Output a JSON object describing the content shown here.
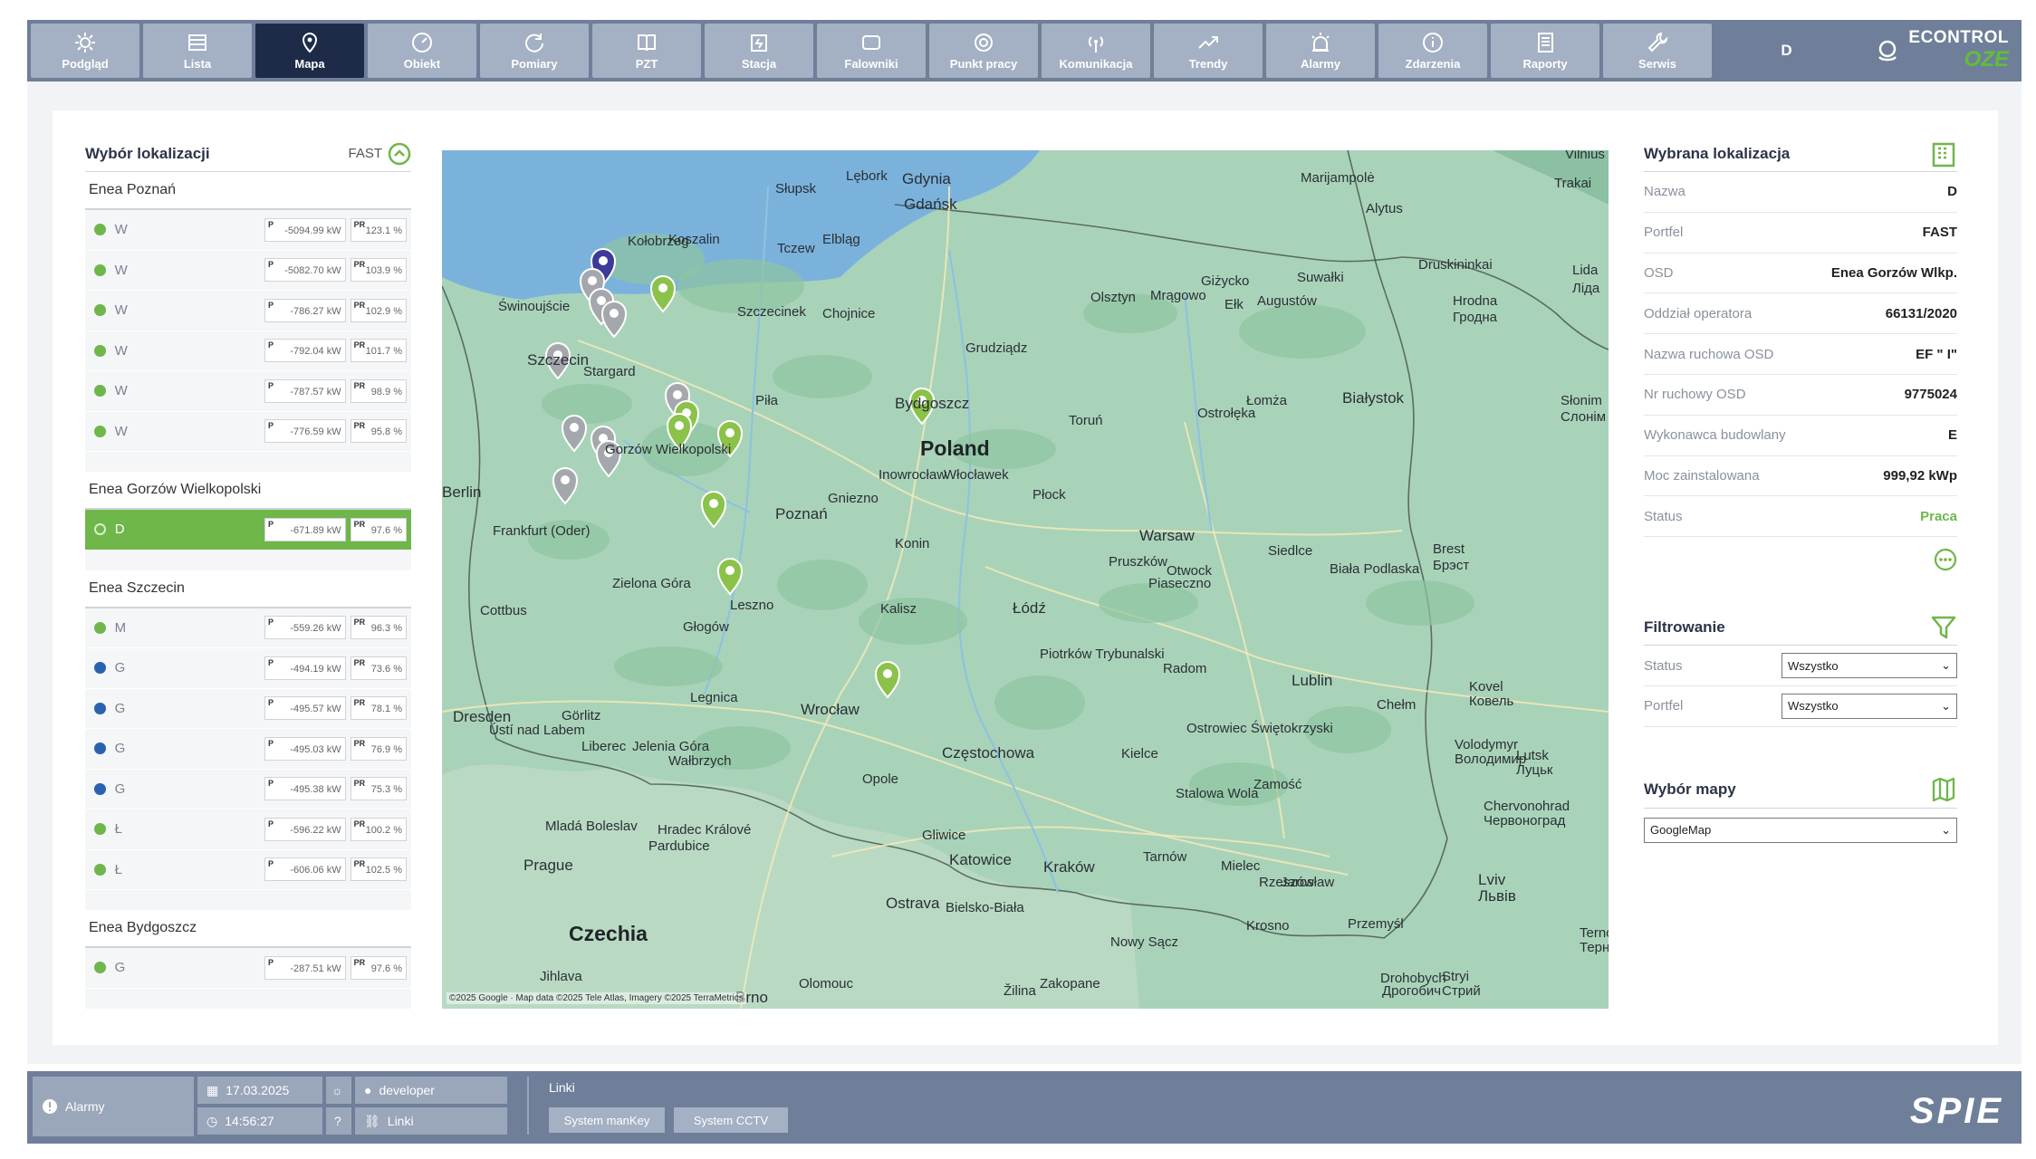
{
  "nav": [
    {
      "label": "Podgląd",
      "icon": "sun-icon"
    },
    {
      "label": "Lista",
      "icon": "list-icon"
    },
    {
      "label": "Mapa",
      "icon": "map-pin-icon",
      "active": true
    },
    {
      "label": "Obiekt",
      "icon": "gauge-icon"
    },
    {
      "label": "Pomiary",
      "icon": "measure-icon"
    },
    {
      "label": "PZT",
      "icon": "book-icon"
    },
    {
      "label": "Stacja",
      "icon": "station-icon"
    },
    {
      "label": "Falowniki",
      "icon": "inverter-icon"
    },
    {
      "label": "Punkt pracy",
      "icon": "target-icon"
    },
    {
      "label": "Komunikacja",
      "icon": "antenna-icon"
    },
    {
      "label": "Trendy",
      "icon": "trend-icon"
    },
    {
      "label": "Alarmy",
      "icon": "siren-icon"
    },
    {
      "label": "Zdarzenia",
      "icon": "info-icon"
    },
    {
      "label": "Raporty",
      "icon": "report-icon"
    },
    {
      "label": "Serwis",
      "icon": "wrench-icon"
    }
  ],
  "header": {
    "user": "D",
    "brand": "ECONTROL",
    "brand_sub": "OZE"
  },
  "left": {
    "title": "Wybór lokalizacji",
    "fast_label": "FAST",
    "groups": [
      {
        "title": "Enea Poznań",
        "rows": [
          {
            "name": "W",
            "p": "-5094.99 kW",
            "pr": "123.1 %",
            "color": "#6fb64b"
          },
          {
            "name": "W",
            "p": "-5082.70 kW",
            "pr": "103.9 %",
            "color": "#6fb64b"
          },
          {
            "name": "W",
            "p": "-786.27 kW",
            "pr": "102.9 %",
            "color": "#6fb64b"
          },
          {
            "name": "W",
            "p": "-792.04 kW",
            "pr": "101.7 %",
            "color": "#6fb64b"
          },
          {
            "name": "W",
            "p": "-787.57 kW",
            "pr": "98.9 %",
            "color": "#6fb64b"
          },
          {
            "name": "W",
            "p": "-776.59 kW",
            "pr": "95.8 %",
            "color": "#6fb64b"
          }
        ]
      },
      {
        "title": "Enea Gorzów Wielkopolski",
        "rows": [
          {
            "name": "D",
            "p": "-671.89 kW",
            "pr": "97.6 %",
            "color": "#6fb64b",
            "selected": true
          }
        ]
      },
      {
        "title": "Enea Szczecin",
        "rows": [
          {
            "name": "M",
            "p": "-559.26 kW",
            "pr": "96.3 %",
            "color": "#6fb64b"
          },
          {
            "name": "G",
            "p": "-494.19 kW",
            "pr": "73.6 %",
            "color": "#2a62b0"
          },
          {
            "name": "G",
            "p": "-495.57 kW",
            "pr": "78.1 %",
            "color": "#2a62b0"
          },
          {
            "name": "G",
            "p": "-495.03 kW",
            "pr": "76.9 %",
            "color": "#2a62b0"
          },
          {
            "name": "G",
            "p": "-495.38 kW",
            "pr": "75.3 %",
            "color": "#2a62b0"
          },
          {
            "name": "Ł",
            "p": "-596.22 kW",
            "pr": "100.2 %",
            "color": "#6fb64b"
          },
          {
            "name": "Ł",
            "p": "-606.06 kW",
            "pr": "102.5 %",
            "color": "#6fb64b"
          }
        ]
      },
      {
        "title": "Enea Bydgoszcz",
        "rows": [
          {
            "name": "G",
            "p": "-287.51 kW",
            "pr": "97.6 %",
            "color": "#6fb64b"
          }
        ]
      }
    ],
    "p_label": "P",
    "pr_label": "PR"
  },
  "map": {
    "attribution": "©2025 Google · Map data ©2025 Tele Atlas, Imagery ©2025 TerraMetrics",
    "country_labels": [
      {
        "text": "Poland",
        "cls": "country"
      },
      {
        "text": "Czechia",
        "cls": "country"
      }
    ],
    "cities": [
      {
        "text": "Gdynia",
        "cls": "mid"
      },
      {
        "text": "Gdańsk",
        "cls": "mid"
      },
      {
        "text": "Słupsk",
        "cls": ""
      },
      {
        "text": "Lębork",
        "cls": ""
      },
      {
        "text": "Kołobrzeg",
        "cls": ""
      },
      {
        "text": "Koszalin",
        "cls": ""
      },
      {
        "text": "Elbląg",
        "cls": ""
      },
      {
        "text": "Tczew",
        "cls": ""
      },
      {
        "text": "Olsztyn",
        "cls": ""
      },
      {
        "text": "Mrągowo",
        "cls": ""
      },
      {
        "text": "Giżycko",
        "cls": ""
      },
      {
        "text": "Ełk",
        "cls": ""
      },
      {
        "text": "Augustów",
        "cls": ""
      },
      {
        "text": "Suwałki",
        "cls": ""
      },
      {
        "text": "Marijampolė",
        "cls": ""
      },
      {
        "text": "Alytus",
        "cls": ""
      },
      {
        "text": "Druskininkai",
        "cls": ""
      },
      {
        "text": "Hrodna",
        "cls": ""
      },
      {
        "text": "Гродна",
        "cls": ""
      },
      {
        "text": "Vilnius",
        "cls": ""
      },
      {
        "text": "Trakai",
        "cls": ""
      },
      {
        "text": "Lida",
        "cls": ""
      },
      {
        "text": "Ліда",
        "cls": ""
      },
      {
        "text": "Szczecin",
        "cls": "mid"
      },
      {
        "text": "Stargard",
        "cls": ""
      },
      {
        "text": "Świnoujście",
        "cls": ""
      },
      {
        "text": "Szczecinek",
        "cls": ""
      },
      {
        "text": "Chojnice",
        "cls": ""
      },
      {
        "text": "Grudziądz",
        "cls": ""
      },
      {
        "text": "Bydgoszcz",
        "cls": "mid"
      },
      {
        "text": "Toruń",
        "cls": ""
      },
      {
        "text": "Piła",
        "cls": ""
      },
      {
        "text": "Ostrołęka",
        "cls": ""
      },
      {
        "text": "Łomża",
        "cls": ""
      },
      {
        "text": "Białystok",
        "cls": "mid"
      },
      {
        "text": "Słonim",
        "cls": ""
      },
      {
        "text": "Слонім",
        "cls": ""
      },
      {
        "text": "Gorzów Wielkopolski",
        "cls": ""
      },
      {
        "text": "Inowrocław",
        "cls": ""
      },
      {
        "text": "Włocławek",
        "cls": ""
      },
      {
        "text": "Płock",
        "cls": ""
      },
      {
        "text": "Gniezno",
        "cls": ""
      },
      {
        "text": "Poznań",
        "cls": "mid"
      },
      {
        "text": "Berlin",
        "cls": "mid"
      },
      {
        "text": "Frankfurt (Oder)",
        "cls": ""
      },
      {
        "text": "Konin",
        "cls": ""
      },
      {
        "text": "Warsaw",
        "cls": "mid"
      },
      {
        "text": "Siedlce",
        "cls": ""
      },
      {
        "text": "Pruszków",
        "cls": ""
      },
      {
        "text": "Otwock",
        "cls": ""
      },
      {
        "text": "Piaseczno",
        "cls": ""
      },
      {
        "text": "Biała Podlaska",
        "cls": ""
      },
      {
        "text": "Brest",
        "cls": ""
      },
      {
        "text": "Брэст",
        "cls": ""
      },
      {
        "text": "Zielona Góra",
        "cls": ""
      },
      {
        "text": "Cottbus",
        "cls": ""
      },
      {
        "text": "Leszno",
        "cls": ""
      },
      {
        "text": "Kalisz",
        "cls": ""
      },
      {
        "text": "Łódź",
        "cls": "mid"
      },
      {
        "text": "Głogów",
        "cls": ""
      },
      {
        "text": "Piotrków Trybunalski",
        "cls": ""
      },
      {
        "text": "Radom",
        "cls": ""
      },
      {
        "text": "Lublin",
        "cls": "mid"
      },
      {
        "text": "Chełm",
        "cls": ""
      },
      {
        "text": "Kovel",
        "cls": ""
      },
      {
        "text": "Ковель",
        "cls": ""
      },
      {
        "text": "Dresden",
        "cls": "mid"
      },
      {
        "text": "Görlitz",
        "cls": ""
      },
      {
        "text": "Legnica",
        "cls": ""
      },
      {
        "text": "Wrocław",
        "cls": "mid"
      },
      {
        "text": "Ostrowiec Świętokrzyski",
        "cls": ""
      },
      {
        "text": "Volodymyr",
        "cls": ""
      },
      {
        "text": "Володимир",
        "cls": ""
      },
      {
        "text": "Lutsk",
        "cls": ""
      },
      {
        "text": "Луцьк",
        "cls": ""
      },
      {
        "text": "Ústí nad Labem",
        "cls": ""
      },
      {
        "text": "Liberec",
        "cls": ""
      },
      {
        "text": "Jelenia Góra",
        "cls": ""
      },
      {
        "text": "Wałbrzych",
        "cls": ""
      },
      {
        "text": "Częstochowa",
        "cls": "mid"
      },
      {
        "text": "Kielce",
        "cls": ""
      },
      {
        "text": "Zamość",
        "cls": ""
      },
      {
        "text": "Stalowa Wola",
        "cls": ""
      },
      {
        "text": "Chervonohrad",
        "cls": ""
      },
      {
        "text": "Червоноград",
        "cls": ""
      },
      {
        "text": "Opole",
        "cls": ""
      },
      {
        "text": "Mladá Boleslav",
        "cls": ""
      },
      {
        "text": "Hradec Králové",
        "cls": ""
      },
      {
        "text": "Pardubice",
        "cls": ""
      },
      {
        "text": "Gliwice",
        "cls": ""
      },
      {
        "text": "Katowice",
        "cls": "mid"
      },
      {
        "text": "Kraków",
        "cls": "mid"
      },
      {
        "text": "Tarnów",
        "cls": ""
      },
      {
        "text": "Mielec",
        "cls": ""
      },
      {
        "text": "Rzeszów",
        "cls": ""
      },
      {
        "text": "Jarosław",
        "cls": ""
      },
      {
        "text": "Prague",
        "cls": "mid"
      },
      {
        "text": "Lviv",
        "cls": "mid"
      },
      {
        "text": "Львів",
        "cls": "mid"
      },
      {
        "text": "Ostrava",
        "cls": "mid"
      },
      {
        "text": "Bielsko-Biała",
        "cls": ""
      },
      {
        "text": "Przemyśl",
        "cls": ""
      },
      {
        "text": "Krosno",
        "cls": ""
      },
      {
        "text": "Nowy Sącz",
        "cls": ""
      },
      {
        "text": "Jihlava",
        "cls": ""
      },
      {
        "text": "Olomouc",
        "cls": ""
      },
      {
        "text": "Žilina",
        "cls": ""
      },
      {
        "text": "Zakopane",
        "cls": ""
      },
      {
        "text": "Drohobych",
        "cls": ""
      },
      {
        "text": "Дрогобич",
        "cls": ""
      },
      {
        "text": "Stryi",
        "cls": ""
      },
      {
        "text": "Стрий",
        "cls": ""
      },
      {
        "text": "Brno",
        "cls": "mid"
      },
      {
        "text": "Terno",
        "cls": ""
      },
      {
        "text": "Терно",
        "cls": ""
      }
    ]
  },
  "right": {
    "title": "Wybrana lokalizacja",
    "fields": [
      {
        "k": "Nazwa",
        "v": "D"
      },
      {
        "k": "Portfel",
        "v": "FAST"
      },
      {
        "k": "OSD",
        "v": "Enea Gorzów Wlkp."
      },
      {
        "k": "Oddział operatora",
        "v": "66131/2020"
      },
      {
        "k": "Nazwa ruchowa OSD",
        "v": "EF \"              I\""
      },
      {
        "k": "Nr ruchowy OSD",
        "v": "9775024"
      },
      {
        "k": "Wykonawca budowlany",
        "v": "E"
      },
      {
        "k": "Moc zainstalowana",
        "v": "999,92 kWp"
      },
      {
        "k": "Status",
        "v": "Praca",
        "green": true
      }
    ],
    "filter_title": "Filtrowanie",
    "filter_status_label": "Status",
    "filter_status_value": "Wszystko",
    "filter_portfel_label": "Portfel",
    "filter_portfel_value": "Wszystko",
    "map_title": "Wybór mapy",
    "map_value": "GoogleMap"
  },
  "bottom": {
    "alarms": "Alarmy",
    "date": "17.03.2025",
    "time": "14:56:27",
    "help": "?",
    "user": "developer",
    "links_btn": "Linki",
    "links_title": "Linki",
    "link1": "System manKey",
    "link2": "System CCTV",
    "logo": "SPIE"
  },
  "colors": {
    "accent_green": "#6fb64b",
    "nav_bg": "#6f7f9a",
    "nav_active": "#1d2a48",
    "blue_status": "#2a62b0"
  }
}
